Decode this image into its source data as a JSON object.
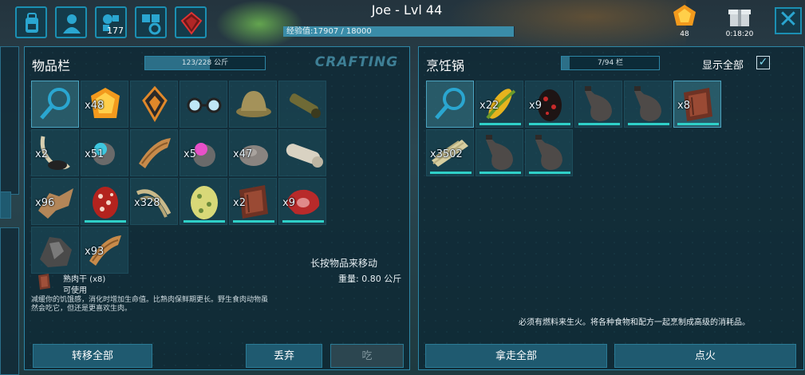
{
  "header": {
    "player": "Joe - Lvl 44",
    "xp_text": "经验值:17907 / 18000",
    "xp_fraction": 0.995,
    "engrams_count": "177",
    "element_count": "48",
    "gift_timer": "0:18:20"
  },
  "inventory": {
    "title": "物品栏",
    "weight": "123/228 公斤",
    "weight_fraction": 0.54,
    "crafting_tab": "CRAFTING",
    "hint": "长按物品来移动",
    "total_weight": "重量: 0.80 公斤",
    "selected_item": {
      "name": "熟肉干 (x8)",
      "status": "可使用",
      "description": "减缓你的饥饿感，消化时增加生命值。比熟肉保鲜期更长。野生食肉动物虽然会吃它，但还是更喜欢生肉。"
    },
    "items": [
      {
        "icon": "search-icon",
        "qty": ""
      },
      {
        "icon": "element-icon",
        "qty": "x48"
      },
      {
        "icon": "implant-icon",
        "qty": ""
      },
      {
        "icon": "glasses-icon",
        "qty": ""
      },
      {
        "icon": "hat-icon",
        "qty": ""
      },
      {
        "icon": "scope-icon",
        "qty": ""
      },
      {
        "icon": "tusk-icon",
        "qty": "x2"
      },
      {
        "icon": "blue-egg-icon",
        "qty": "x51"
      },
      {
        "icon": "wood-icon",
        "qty": ""
      },
      {
        "icon": "pink-egg-icon",
        "qty": "x5"
      },
      {
        "icon": "stone-icon",
        "qty": "x47"
      },
      {
        "icon": "log-icon",
        "qty": ""
      },
      {
        "icon": "hide-icon",
        "qty": "x96"
      },
      {
        "icon": "red-egg-icon",
        "qty": ""
      },
      {
        "icon": "fiber-icon",
        "qty": "x328"
      },
      {
        "icon": "yellow-egg-icon",
        "qty": ""
      },
      {
        "icon": "jerky-icon",
        "qty": "x2"
      },
      {
        "icon": "raw-meat-icon",
        "qty": "x9"
      },
      {
        "icon": "flint-icon",
        "qty": ""
      },
      {
        "icon": "wood-icon",
        "qty": "x93"
      }
    ],
    "buttons": {
      "transfer_all": "转移全部",
      "drop": "丢弃",
      "eat": "吃"
    }
  },
  "cooking_pot": {
    "title": "烹饪锅",
    "slots": "7/94 栏",
    "slots_fraction": 0.08,
    "show_all": "显示全部",
    "show_all_checked": "✓",
    "items": [
      {
        "icon": "search-icon",
        "qty": ""
      },
      {
        "icon": "corn-icon",
        "qty": "x22"
      },
      {
        "icon": "dark-egg-icon",
        "qty": "x9"
      },
      {
        "icon": "waterskin-icon",
        "qty": ""
      },
      {
        "icon": "waterskin-icon",
        "qty": ""
      },
      {
        "icon": "jerky-icon",
        "qty": "x8"
      },
      {
        "icon": "thatch-icon",
        "qty": "x3502"
      },
      {
        "icon": "waterskin-icon",
        "qty": ""
      },
      {
        "icon": "waterskin-icon",
        "qty": ""
      }
    ],
    "message": "必须有燃料来生火。将各种食物和配方一起烹制成高级的消耗品。",
    "buttons": {
      "take_all": "拿走全部",
      "light_fire": "点火"
    }
  }
}
